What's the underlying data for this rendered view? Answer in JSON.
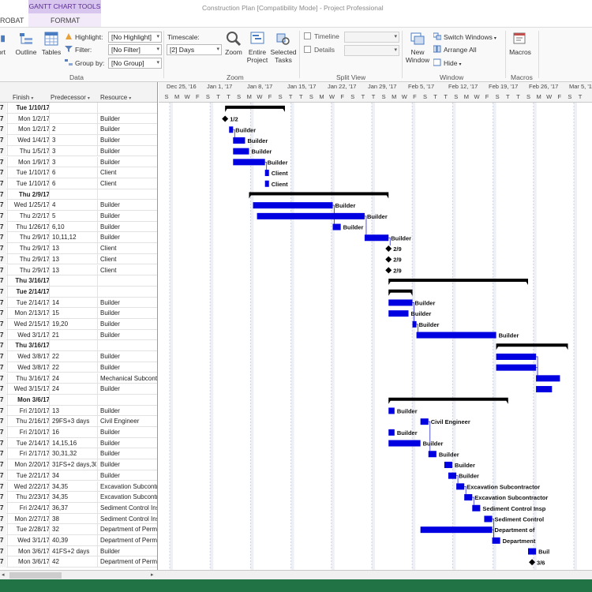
{
  "window": {
    "title": "Construction Plan [Compatibility Mode] - Project Professional",
    "context_tools": "GANTT CHART TOOLS",
    "tabs": [
      "ROBAT",
      "FORMAT"
    ]
  },
  "ribbon": {
    "buttons": {
      "sort": "ort",
      "outline": "Outline",
      "tables": "Tables",
      "zoom": "Zoom",
      "entire_project": [
        "Entire",
        "Project"
      ],
      "selected_tasks": [
        "Selected",
        "Tasks"
      ],
      "new_window": [
        "New",
        "Window"
      ],
      "macros": "Macros"
    },
    "data": {
      "highlight_label": "Highlight:",
      "highlight_value": "[No Highlight]",
      "filter_label": "Filter:",
      "filter_value": "[No Filter]",
      "group_label": "Group by:",
      "group_value": "[No Group]"
    },
    "timescale_label": "Timescale:",
    "timescale_value": "[2] Days",
    "timeline_label": "Timeline",
    "details_label": "Details",
    "window": {
      "switch_windows": "Switch Windows",
      "arrange_all": "Arrange All",
      "hide": "Hide"
    },
    "groups": {
      "data": "Data",
      "zoom": "Zoom",
      "split_view": "Split View",
      "window": "Window",
      "macros": "Macros"
    }
  },
  "table": {
    "columns": [
      "Finish",
      "Predecessor",
      "Resource"
    ],
    "rows": [
      {
        "finish": "Tue 1/10/17",
        "pred": "",
        "res": "",
        "summary": true
      },
      {
        "finish": "Mon 1/2/17",
        "pred": "",
        "res": "Builder"
      },
      {
        "finish": "Mon 1/2/17",
        "pred": "2",
        "res": "Builder"
      },
      {
        "finish": "Wed 1/4/17",
        "pred": "3",
        "res": "Builder"
      },
      {
        "finish": "Thu 1/5/17",
        "pred": "3",
        "res": "Builder"
      },
      {
        "finish": "Mon 1/9/17",
        "pred": "3",
        "res": "Builder"
      },
      {
        "finish": "Tue 1/10/17",
        "pred": "6",
        "res": "Client"
      },
      {
        "finish": "Tue 1/10/17",
        "pred": "6",
        "res": "Client"
      },
      {
        "finish": "Thu 2/9/17",
        "pred": "",
        "res": "",
        "summary": true
      },
      {
        "finish": "Wed 1/25/17",
        "pred": "4",
        "res": "Builder"
      },
      {
        "finish": "Thu 2/2/17",
        "pred": "5",
        "res": "Builder"
      },
      {
        "finish": "Thu 1/26/17",
        "pred": "6,10",
        "res": "Builder"
      },
      {
        "finish": "Thu 2/9/17",
        "pred": "10,11,12",
        "res": "Builder"
      },
      {
        "finish": "Thu 2/9/17",
        "pred": "13",
        "res": "Client"
      },
      {
        "finish": "Thu 2/9/17",
        "pred": "13",
        "res": "Client"
      },
      {
        "finish": "Thu 2/9/17",
        "pred": "13",
        "res": "Client"
      },
      {
        "finish": "Thu 3/16/17",
        "pred": "",
        "res": "",
        "summary": true
      },
      {
        "finish": "Tue 2/14/17",
        "pred": "",
        "res": "",
        "summary": true
      },
      {
        "finish": "Tue 2/14/17",
        "pred": "14",
        "res": "Builder"
      },
      {
        "finish": "Mon 2/13/17",
        "pred": "15",
        "res": "Builder"
      },
      {
        "finish": "Wed 2/15/17",
        "pred": "19,20",
        "res": "Builder"
      },
      {
        "finish": "Wed 3/1/17",
        "pred": "21",
        "res": "Builder"
      },
      {
        "finish": "Thu 3/16/17",
        "pred": "",
        "res": "",
        "summary": true
      },
      {
        "finish": "Wed 3/8/17",
        "pred": "22",
        "res": "Builder"
      },
      {
        "finish": "Wed 3/8/17",
        "pred": "22",
        "res": "Builder"
      },
      {
        "finish": "Thu 3/16/17",
        "pred": "24",
        "res": "Mechanical Subcontr"
      },
      {
        "finish": "Wed 3/15/17",
        "pred": "24",
        "res": "Builder"
      },
      {
        "finish": "Mon 3/6/17",
        "pred": "",
        "res": "",
        "summary": true
      },
      {
        "finish": "Fri 2/10/17",
        "pred": "13",
        "res": "Builder"
      },
      {
        "finish": "Thu 2/16/17",
        "pred": "29FS+3 days",
        "res": "Civil Engineer"
      },
      {
        "finish": "Fri 2/10/17",
        "pred": "16",
        "res": "Builder"
      },
      {
        "finish": "Tue 2/14/17",
        "pred": "14,15,16",
        "res": "Builder"
      },
      {
        "finish": "Fri 2/17/17",
        "pred": "30,31,32",
        "res": "Builder"
      },
      {
        "finish": "Mon 2/20/17",
        "pred": "31FS+2 days,30,",
        "res": "Builder"
      },
      {
        "finish": "Tue 2/21/17",
        "pred": "34",
        "res": "Builder"
      },
      {
        "finish": "Wed 2/22/17",
        "pred": "34,35",
        "res": "Excavation Subcontr"
      },
      {
        "finish": "Thu 2/23/17",
        "pred": "34,35",
        "res": "Excavation Subcontr"
      },
      {
        "finish": "Fri 2/24/17",
        "pred": "36,37",
        "res": "Sediment Control Ins"
      },
      {
        "finish": "Mon 2/27/17",
        "pred": "38",
        "res": "Sediment Control Ins"
      },
      {
        "finish": "Tue 2/28/17",
        "pred": "32",
        "res": "Department of Permit"
      },
      {
        "finish": "Wed 3/1/17",
        "pred": "40,39",
        "res": "Department of Permit"
      },
      {
        "finish": "Mon 3/6/17",
        "pred": "41FS+2 days",
        "res": "Builder"
      },
      {
        "finish": "Mon 3/6/17",
        "pred": "42",
        "res": "Department of Permit"
      }
    ]
  },
  "timescale": {
    "weeks": [
      "Dec 25, '16",
      "Jan 1, '17",
      "Jan 8, '17",
      "Jan 15, '17",
      "Jan 22, '17",
      "Jan 29, '17",
      "Feb 5, '17",
      "Feb 12, '17",
      "Feb 19, '17",
      "Feb 26, '17",
      "Mar 5, '17"
    ],
    "day_letters": [
      "S",
      "M",
      "W",
      "F",
      "S",
      "T",
      "T",
      "S",
      "M",
      "W",
      "F",
      "S",
      "T",
      "T",
      "S",
      "M",
      "W",
      "F",
      "S",
      "T",
      "T",
      "S",
      "M",
      "W",
      "F",
      "S",
      "T",
      "T",
      "S",
      "M",
      "W",
      "F",
      "S",
      "T",
      "T",
      "S",
      "M",
      "W",
      "F",
      "S",
      "T"
    ]
  },
  "gantt": {
    "start_offset": 0,
    "bar_color": "#0000e0",
    "summary_color": "#000000",
    "tasks": [
      {
        "type": "summary",
        "s": 4,
        "e": 19
      },
      {
        "type": "milestone",
        "s": 4,
        "label": "1/2"
      },
      {
        "type": "bar",
        "s": 5,
        "e": 6,
        "label": "Builder"
      },
      {
        "type": "bar",
        "s": 6,
        "e": 9,
        "label": "Builder"
      },
      {
        "type": "bar",
        "s": 6,
        "e": 10,
        "label": "Builder"
      },
      {
        "type": "bar",
        "s": 6,
        "e": 14,
        "label": "Builder"
      },
      {
        "type": "bar",
        "s": 14,
        "e": 15,
        "label": "Client"
      },
      {
        "type": "bar",
        "s": 14,
        "e": 15,
        "label": "Client"
      },
      {
        "type": "summary",
        "s": 10,
        "e": 45
      },
      {
        "type": "bar",
        "s": 11,
        "e": 31,
        "label": "Builder"
      },
      {
        "type": "bar",
        "s": 12,
        "e": 39,
        "label": "Builder"
      },
      {
        "type": "bar",
        "s": 31,
        "e": 33,
        "label": "Builder"
      },
      {
        "type": "bar",
        "s": 39,
        "e": 45,
        "label": "Builder"
      },
      {
        "type": "milestone",
        "s": 45,
        "label": "2/9"
      },
      {
        "type": "milestone",
        "s": 45,
        "label": "2/9"
      },
      {
        "type": "milestone",
        "s": 45,
        "label": "2/9"
      },
      {
        "type": "summary",
        "s": 45,
        "e": 80
      },
      {
        "type": "summary",
        "s": 45,
        "e": 51
      },
      {
        "type": "bar",
        "s": 45,
        "e": 51,
        "label": "Builder"
      },
      {
        "type": "bar",
        "s": 45,
        "e": 50,
        "label": "Builder"
      },
      {
        "type": "bar",
        "s": 51,
        "e": 52,
        "label": "Builder"
      },
      {
        "type": "bar",
        "s": 52,
        "e": 72,
        "label": "Builder"
      },
      {
        "type": "summary",
        "s": 72,
        "e": 90
      },
      {
        "type": "bar",
        "s": 72,
        "e": 82,
        "label": ""
      },
      {
        "type": "bar",
        "s": 72,
        "e": 82,
        "label": ""
      },
      {
        "type": "bar",
        "s": 82,
        "e": 88,
        "label": ""
      },
      {
        "type": "bar",
        "s": 82,
        "e": 86,
        "label": ""
      },
      {
        "type": "summary",
        "s": 45,
        "e": 75
      },
      {
        "type": "bar",
        "s": 45,
        "e": 46.5,
        "label": "Builder"
      },
      {
        "type": "bar",
        "s": 53,
        "e": 55,
        "label": "Civil Engineer"
      },
      {
        "type": "bar",
        "s": 45,
        "e": 46.5,
        "label": "Builder"
      },
      {
        "type": "bar",
        "s": 45,
        "e": 53,
        "label": "Builder"
      },
      {
        "type": "bar",
        "s": 55,
        "e": 57,
        "label": "Builder"
      },
      {
        "type": "bar",
        "s": 59,
        "e": 61,
        "label": "Builder"
      },
      {
        "type": "bar",
        "s": 60,
        "e": 62,
        "label": "Builder"
      },
      {
        "type": "bar",
        "s": 62,
        "e": 64,
        "label": "Excavation Subcontractor"
      },
      {
        "type": "bar",
        "s": 64,
        "e": 66,
        "label": "Excavation Subcontractor"
      },
      {
        "type": "bar",
        "s": 66,
        "e": 68,
        "label": "Sediment Control Insp"
      },
      {
        "type": "bar",
        "s": 69,
        "e": 71,
        "label": "Sediment Control"
      },
      {
        "type": "bar",
        "s": 53,
        "e": 71,
        "label": "Department of"
      },
      {
        "type": "bar",
        "s": 71,
        "e": 73,
        "label": "Department"
      },
      {
        "type": "bar",
        "s": 80,
        "e": 82,
        "label": "Buil"
      },
      {
        "type": "milestone",
        "s": 81,
        "label": "3/6"
      }
    ]
  }
}
